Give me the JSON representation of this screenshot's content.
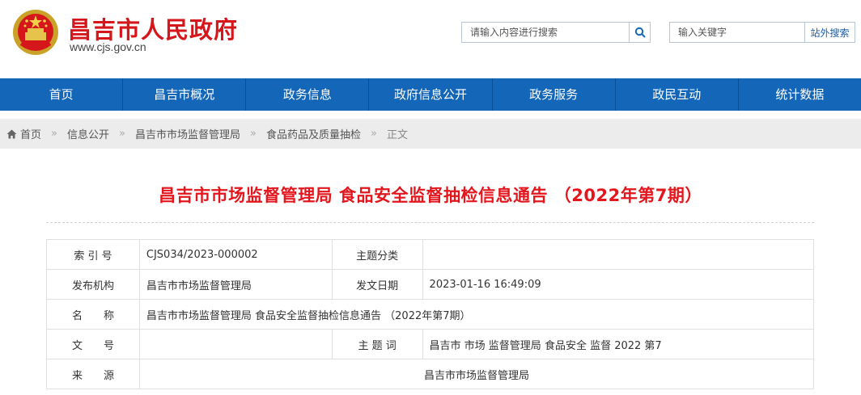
{
  "header": {
    "site_title": "昌吉市人民政府",
    "site_domain": "www.cjs.gov.cn",
    "search_placeholder": "请输入内容进行搜索",
    "keyword_placeholder": "输入关键字",
    "offsite_search_label": "站外搜索"
  },
  "nav": {
    "items": [
      "首页",
      "昌吉市概况",
      "政务信息",
      "政府信息公开",
      "政务服务",
      "政民互动",
      "统计数据"
    ]
  },
  "breadcrumb": {
    "items": [
      "首页",
      "信息公开",
      "昌吉市市场监督管理局",
      "食品药品及质量抽检",
      "正文"
    ],
    "separator": "»"
  },
  "article": {
    "title": "昌吉市市场监督管理局 食品安全监督抽检信息通告 （2022年第7期）"
  },
  "info_table": {
    "index_label": "索 引 号",
    "index_value": "CJS034/2023-000002",
    "topic_label": "主题分类",
    "topic_value": "",
    "issuer_label": "发布机构",
    "issuer_value": "昌吉市市场监督管理局",
    "date_label": "发文日期",
    "date_value": "2023-01-16 16:49:09",
    "name_label": "名　　称",
    "name_value": "昌吉市市场监督管理局 食品安全监督抽检信息通告 （2022年第7期）",
    "docno_label": "文　　号",
    "docno_value": "",
    "keywords_label": "主 题 词",
    "keywords_value": "昌吉市 市场 监督管理局 食品安全 监督 2022 第7",
    "source_label": "来　　源",
    "source_value": "昌吉市市场监督管理局"
  },
  "colors": {
    "brand_red": "#d5161b",
    "nav_blue": "#1466b9"
  }
}
